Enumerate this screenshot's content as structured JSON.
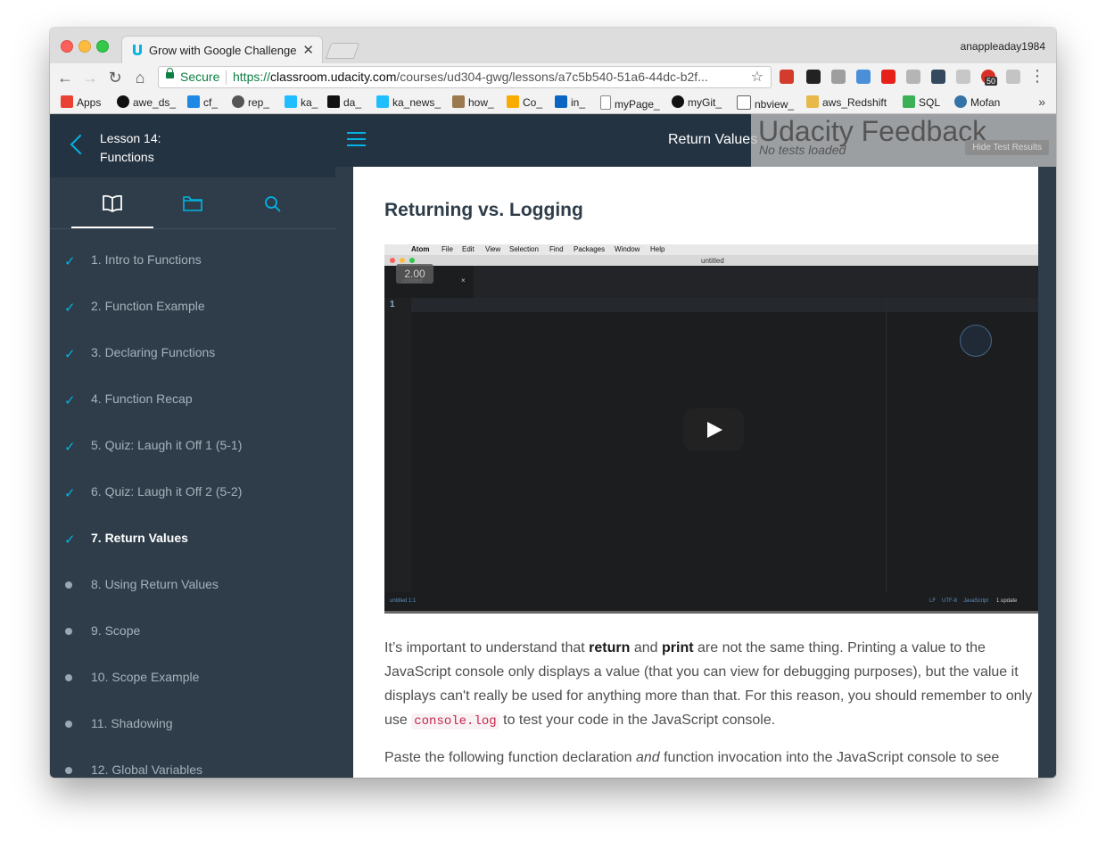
{
  "browser": {
    "tab_title": "Grow with Google Challenge S",
    "tab_close": "✕",
    "profile_name": "anappleaday1984",
    "secure_label": "Secure",
    "url_scheme": "https://",
    "url_host": "classroom.udacity.com",
    "url_path": "/courses/ud304-gwg/lessons/a7c5b540-51a6-44dc-b2f...",
    "badge_count": "50",
    "bookmarks": [
      {
        "label": "Apps",
        "icon": "apps-grid-icon",
        "color": "#e94235"
      },
      {
        "label": "awe_ds_",
        "icon": "github-icon",
        "color": "#111111"
      },
      {
        "label": "cf_",
        "icon": "codeforces-icon",
        "color": "#1e88e5"
      },
      {
        "label": "rep_",
        "icon": "repl-icon",
        "color": "#555555"
      },
      {
        "label": "ka_",
        "icon": "kaggle-icon",
        "color": "#20beff"
      },
      {
        "label": "da_",
        "icon": "t-icon",
        "color": "#111111"
      },
      {
        "label": "ka_news_",
        "icon": "kaggle-icon",
        "color": "#20beff"
      },
      {
        "label": "how_",
        "icon": "owl-icon",
        "color": "#9c7a4d"
      },
      {
        "label": "Co_",
        "icon": "colab-icon",
        "color": "#f9ab00"
      },
      {
        "label": "in_",
        "icon": "linkedin-icon",
        "color": "#0a66c2"
      },
      {
        "label": "myPage_",
        "icon": "page-icon",
        "color": "#888888"
      },
      {
        "label": "myGit_",
        "icon": "github-icon",
        "color": "#111111"
      },
      {
        "label": "nbview_",
        "icon": "nbviewer-icon",
        "color": "#666666"
      },
      {
        "label": "aws_Redshift",
        "icon": "folder-icon",
        "color": "#e8b84a"
      },
      {
        "label": "SQL",
        "icon": "sql-icon",
        "color": "#3cb054"
      },
      {
        "label": "Mofan",
        "icon": "python-icon",
        "color": "#3572a5"
      }
    ],
    "more_bookmarks": "»"
  },
  "sidebar": {
    "lesson_title": "Lesson 14:\nFunctions",
    "items": [
      {
        "label": "1. Intro to Functions",
        "done": true
      },
      {
        "label": "2. Function Example",
        "done": true
      },
      {
        "label": "3. Declaring Functions",
        "done": true
      },
      {
        "label": "4. Function Recap",
        "done": true
      },
      {
        "label": "5. Quiz: Laugh it Off 1 (5-1)",
        "done": true
      },
      {
        "label": "6. Quiz: Laugh it Off 2 (5-2)",
        "done": true
      },
      {
        "label": "7. Return Values",
        "done": true,
        "current": true
      },
      {
        "label": "8. Using Return Values",
        "done": false
      },
      {
        "label": "9. Scope",
        "done": false
      },
      {
        "label": "10. Scope Example",
        "done": false
      },
      {
        "label": "11. Shadowing",
        "done": false
      },
      {
        "label": "12. Global Variables",
        "done": false
      }
    ],
    "check_glyph": "✓"
  },
  "topbar": {
    "title": "Return Values"
  },
  "feedback": {
    "title": "Udacity Feedback",
    "subtitle": "No tests loaded",
    "button": "Hide Test Results"
  },
  "content": {
    "heading": "Returning vs. Logging",
    "para1_a": "It’s important to understand that ",
    "para1_return": "return",
    "para1_b": " and ",
    "para1_print": "print",
    "para1_c": " are not the same thing. Printing a value to the JavaScript console only displays a value (that you can view for debugging purposes), but the value it displays can't really be used for anything more than that. For this reason, you should remember to only use ",
    "para1_code": "console.log",
    "para1_d": " to test your code in the JavaScript console.",
    "para2_a": "Paste the following function declaration ",
    "para2_and": "and",
    "para2_b": " function invocation into the JavaScript console to see"
  },
  "video": {
    "speed": "2.00",
    "menu": [
      "Atom",
      "File",
      "Edit",
      "View",
      "Selection",
      "Find",
      "Packages",
      "Window",
      "Help"
    ],
    "window_title": "untitled",
    "tab_name": "untitled",
    "tab_close": "×",
    "line_number": "1",
    "status_left": "untitled   1:1",
    "status_lf": "LF",
    "status_encoding": "UTF-8",
    "status_grammar": "JavaScript",
    "status_updates": "1 update"
  }
}
